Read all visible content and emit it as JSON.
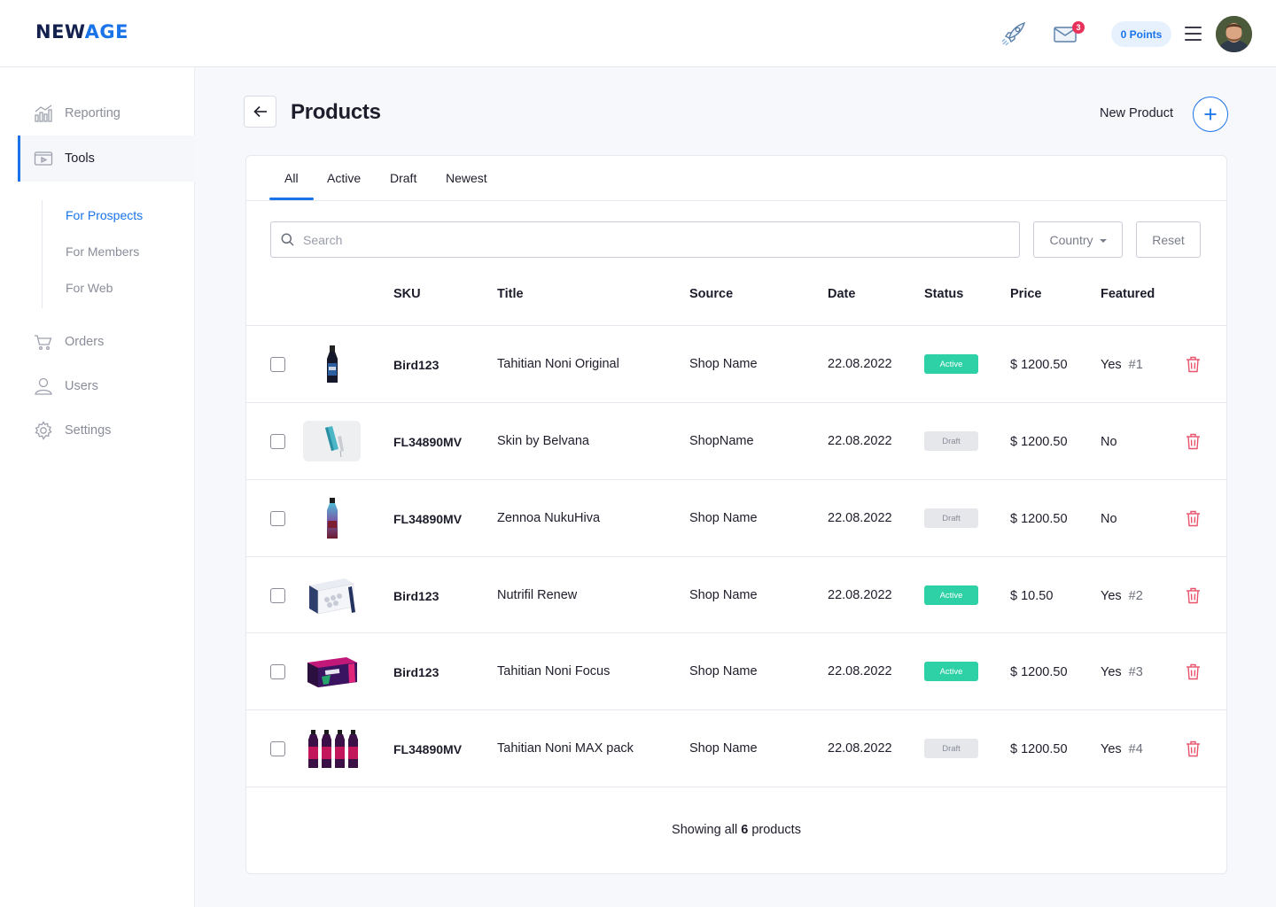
{
  "brand": {
    "logo_new": "NEW",
    "logo_age": "AGE"
  },
  "topbar": {
    "mail_badge": "3",
    "points_label": "0 Points",
    "icons": [
      "rocket-icon",
      "mail-icon",
      "hamburger-icon",
      "avatar"
    ]
  },
  "sidebar": {
    "items": [
      {
        "label": "Reporting",
        "icon": "chart-icon"
      },
      {
        "label": "Tools",
        "icon": "tools-icon",
        "active": true
      },
      {
        "label": "Orders",
        "icon": "cart-icon"
      },
      {
        "label": "Users",
        "icon": "user-icon"
      },
      {
        "label": "Settings",
        "icon": "gear-icon"
      }
    ],
    "sub_items": [
      {
        "label": "For Prospects",
        "current": true
      },
      {
        "label": "For Members"
      },
      {
        "label": "For Web"
      }
    ]
  },
  "header": {
    "title": "Products",
    "new_product_label": "New Product"
  },
  "tabs": [
    {
      "label": "All",
      "active": true
    },
    {
      "label": "Active"
    },
    {
      "label": "Draft"
    },
    {
      "label": "Newest"
    }
  ],
  "filters": {
    "search_placeholder": "Search",
    "country_label": "Country",
    "reset_label": "Reset"
  },
  "table": {
    "columns": [
      "SKU",
      "Title",
      "Source",
      "Date",
      "Status",
      "Price",
      "Featured"
    ],
    "rows": [
      {
        "sku": "Bird123",
        "title": "Tahitian Noni Original",
        "source": "Shop Name",
        "date": "22.08.2022",
        "status": "Active",
        "price": "$ 1200.50",
        "featured": "Yes",
        "featured_num": "#1",
        "image": "bottle-dark"
      },
      {
        "sku": "FL34890MV",
        "title": "Skin by Belvana",
        "source": "ShopName",
        "date": "22.08.2022",
        "status": "Draft",
        "price": "$ 1200.50",
        "featured": "No",
        "featured_num": "",
        "image": "skincare-tubes"
      },
      {
        "sku": "FL34890MV",
        "title": "Zennoa NukuHiva",
        "source": "Shop Name",
        "date": "22.08.2022",
        "status": "Draft",
        "price": "$ 1200.50",
        "featured": "No",
        "featured_num": "",
        "image": "bottle-gradient"
      },
      {
        "sku": "Bird123",
        "title": "Nutrifil Renew",
        "source": "Shop Name",
        "date": "22.08.2022",
        "status": "Active",
        "price": "$ 10.50",
        "featured": "Yes",
        "featured_num": "#2",
        "image": "box-sachets"
      },
      {
        "sku": "Bird123",
        "title": "Tahitian Noni Focus",
        "source": "Shop Name",
        "date": "22.08.2022",
        "status": "Active",
        "price": "$ 1200.50",
        "featured": "Yes",
        "featured_num": "#3",
        "image": "box-pink"
      },
      {
        "sku": "FL34890MV",
        "title": "Tahitian Noni MAX pack",
        "source": "Shop Name",
        "date": "22.08.2022",
        "status": "Draft",
        "price": "$ 1200.50",
        "featured": "Yes",
        "featured_num": "#4",
        "image": "bottles-four"
      }
    ]
  },
  "footer": {
    "prefix": "Showing all",
    "count": "6",
    "suffix": "products"
  },
  "colors": {
    "accent": "#1a73e8",
    "active_status": "#2ed1a6",
    "draft_status": "#e6e7ea",
    "danger": "#e8536b",
    "badge": "#e8315b"
  }
}
